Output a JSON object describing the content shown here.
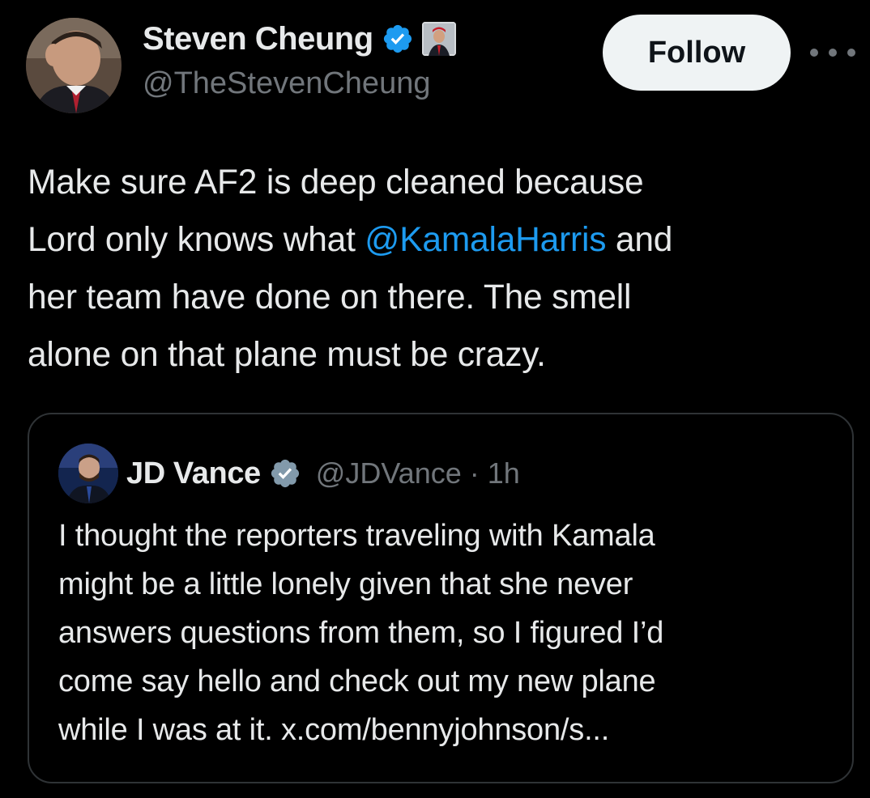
{
  "tweet": {
    "author": {
      "name": "Steven Cheung",
      "handle": "@TheStevenCheung",
      "verified": true,
      "avatar_icon": "profile-photo",
      "affiliate_badge_icon": "affiliate-badge"
    },
    "follow_label": "Follow",
    "more_icon": "more-options-icon",
    "text_lines": [
      {
        "before": "Make sure AF2 is deep cleaned because",
        "mention": "",
        "after": ""
      },
      {
        "before": "Lord only knows what ",
        "mention": "@KamalaHarris",
        "after": " and"
      },
      {
        "before": "her team have done on there. The smell",
        "mention": "",
        "after": ""
      },
      {
        "before": "alone on that plane must be crazy.",
        "mention": "",
        "after": ""
      }
    ]
  },
  "quoted_tweet": {
    "author": {
      "name": "JD Vance",
      "handle": "@JDVance",
      "verified": true,
      "avatar_icon": "profile-photo"
    },
    "separator": "·",
    "time": "1h",
    "text_lines": [
      "I thought the reporters traveling with Kamala",
      "might be a little lonely given that she never",
      "answers questions from them, so I figured I’d",
      "come say hello and check out my new plane",
      "while I was at it. x.com/bennyjohnson/s..."
    ]
  },
  "colors": {
    "background": "#000000",
    "text_primary": "#e7e9ea",
    "text_secondary": "#71767b",
    "link": "#1d9bf0",
    "follow_button_bg": "#eff3f4",
    "border": "#2f3336"
  }
}
